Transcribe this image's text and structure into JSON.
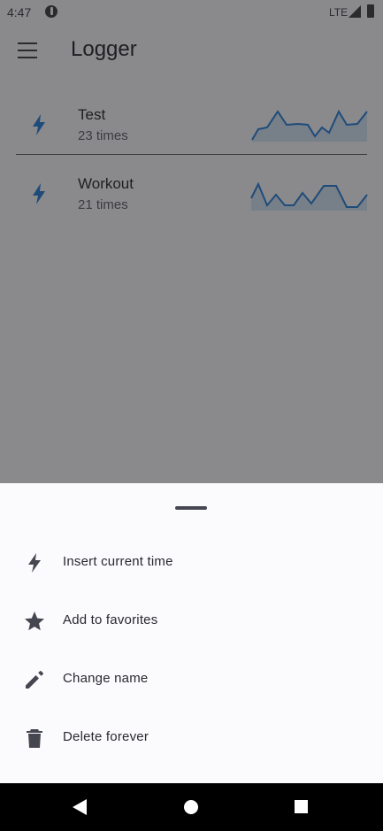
{
  "status": {
    "time": "4:47",
    "network": "LTE"
  },
  "appbar": {
    "title": "Logger"
  },
  "loggers": [
    {
      "name": "Test",
      "count": "23 times"
    },
    {
      "name": "Workout",
      "count": "21 times"
    }
  ],
  "sheet": {
    "items": [
      {
        "label": "Insert current time",
        "icon": "bolt-icon"
      },
      {
        "label": "Add to favorites",
        "icon": "star-icon"
      },
      {
        "label": "Change name",
        "icon": "pencil-icon"
      },
      {
        "label": "Delete forever",
        "icon": "trash-icon"
      }
    ]
  },
  "colors": {
    "accent": "#1f4b7a",
    "scrim": "#8a8a8d",
    "sheet": "#fbfbfe"
  }
}
